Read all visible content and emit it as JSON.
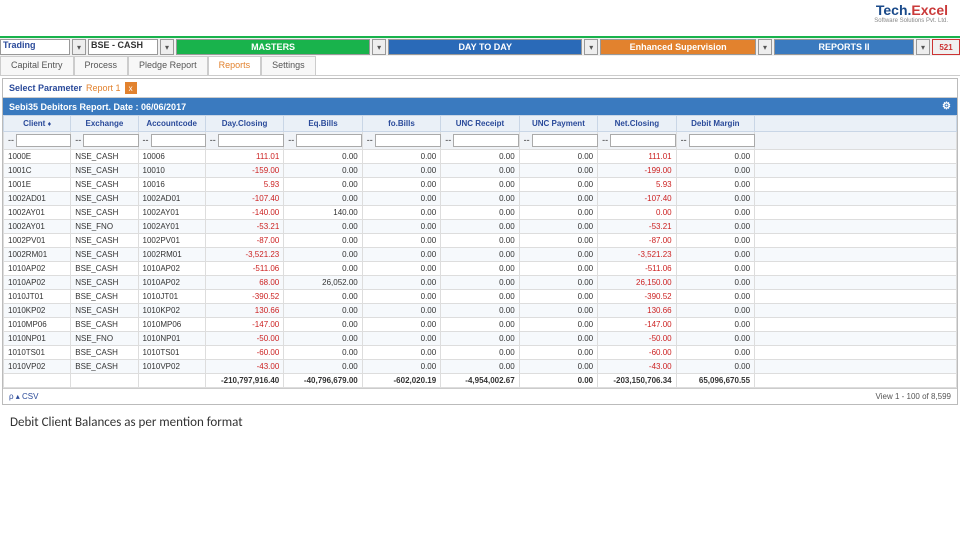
{
  "brand": {
    "name_a": "Tech.",
    "name_b": "Excel",
    "tag": "Software Solutions Pvt. Ltd."
  },
  "topbar": {
    "trading": "Trading",
    "bse": "BSE - CASH",
    "masters": "MASTERS",
    "daytoday": "DAY TO DAY",
    "enhanced": "Enhanced Supervision",
    "reports": "REPORTS II",
    "badge": "521"
  },
  "subnav": {
    "t0": "Capital Entry",
    "t1": "Process",
    "t2": "Pledge Report",
    "t3": "Reports",
    "t4": "Settings"
  },
  "param": {
    "label": "Select Parameter",
    "value": "Report 1",
    "close": "x"
  },
  "title": "Sebi35 Debitors Report. Date : 06/06/2017",
  "headers": {
    "client": "Client",
    "exchange": "Exchange",
    "account": "Accountcode",
    "dayclosing": "Day.Closing",
    "eqbills": "Eq.Bills",
    "fobills": "fo.Bills",
    "uncreceipt": "UNC Receipt",
    "uncpayment": "UNC Payment",
    "netclosing": "Net.Closing",
    "debitmargin": "Debit Margin"
  },
  "filter_dash": "--",
  "rows": [
    {
      "c": "1000E",
      "e": "NSE_CASH",
      "a": "10006",
      "dc": "111.01",
      "eq": "0.00",
      "fo": "0.00",
      "ur": "0.00",
      "up": "0.00",
      "nc": "111.01",
      "dm": "0.00",
      "dcn": false,
      "ncn": false
    },
    {
      "c": "1001C",
      "e": "NSE_CASH",
      "a": "10010",
      "dc": "-159.00",
      "eq": "0.00",
      "fo": "0.00",
      "ur": "0.00",
      "up": "0.00",
      "nc": "-199.00",
      "dm": "0.00",
      "dcn": true,
      "ncn": true
    },
    {
      "c": "1001E",
      "e": "NSE_CASH",
      "a": "10016",
      "dc": "5.93",
      "eq": "0.00",
      "fo": "0.00",
      "ur": "0.00",
      "up": "0.00",
      "nc": "5.93",
      "dm": "0.00",
      "dcn": false,
      "ncn": false
    },
    {
      "c": "1002AD01",
      "e": "NSE_CASH",
      "a": "1002AD01",
      "dc": "-107.40",
      "eq": "0.00",
      "fo": "0.00",
      "ur": "0.00",
      "up": "0.00",
      "nc": "-107.40",
      "dm": "0.00",
      "dcn": true,
      "ncn": true
    },
    {
      "c": "1002AY01",
      "e": "NSE_CASH",
      "a": "1002AY01",
      "dc": "-140.00",
      "eq": "140.00",
      "fo": "0.00",
      "ur": "0.00",
      "up": "0.00",
      "nc": "0.00",
      "dm": "0.00",
      "dcn": true,
      "ncn": false
    },
    {
      "c": "1002AY01",
      "e": "NSE_FNO",
      "a": "1002AY01",
      "dc": "-53.21",
      "eq": "0.00",
      "fo": "0.00",
      "ur": "0.00",
      "up": "0.00",
      "nc": "-53.21",
      "dm": "0.00",
      "dcn": true,
      "ncn": true
    },
    {
      "c": "1002PV01",
      "e": "NSE_CASH",
      "a": "1002PV01",
      "dc": "-87.00",
      "eq": "0.00",
      "fo": "0.00",
      "ur": "0.00",
      "up": "0.00",
      "nc": "-87.00",
      "dm": "0.00",
      "dcn": true,
      "ncn": true
    },
    {
      "c": "1002RM01",
      "e": "NSE_CASH",
      "a": "1002RM01",
      "dc": "-3,521.23",
      "eq": "0.00",
      "fo": "0.00",
      "ur": "0.00",
      "up": "0.00",
      "nc": "-3,521.23",
      "dm": "0.00",
      "dcn": true,
      "ncn": true
    },
    {
      "c": "1010AP02",
      "e": "BSE_CASH",
      "a": "1010AP02",
      "dc": "-511.06",
      "eq": "0.00",
      "fo": "0.00",
      "ur": "0.00",
      "up": "0.00",
      "nc": "-511.06",
      "dm": "0.00",
      "dcn": true,
      "ncn": true
    },
    {
      "c": "1010AP02",
      "e": "NSE_CASH",
      "a": "1010AP02",
      "dc": "68.00",
      "eq": "26,052.00",
      "fo": "0.00",
      "ur": "0.00",
      "up": "0.00",
      "nc": "26,150.00",
      "dm": "0.00",
      "dcn": false,
      "ncn": false
    },
    {
      "c": "1010JT01",
      "e": "BSE_CASH",
      "a": "1010JT01",
      "dc": "-390.52",
      "eq": "0.00",
      "fo": "0.00",
      "ur": "0.00",
      "up": "0.00",
      "nc": "-390.52",
      "dm": "0.00",
      "dcn": true,
      "ncn": true
    },
    {
      "c": "1010KP02",
      "e": "NSE_CASH",
      "a": "1010KP02",
      "dc": "130.66",
      "eq": "0.00",
      "fo": "0.00",
      "ur": "0.00",
      "up": "0.00",
      "nc": "130.66",
      "dm": "0.00",
      "dcn": false,
      "ncn": false
    },
    {
      "c": "1010MP06",
      "e": "BSE_CASH",
      "a": "1010MP06",
      "dc": "-147.00",
      "eq": "0.00",
      "fo": "0.00",
      "ur": "0.00",
      "up": "0.00",
      "nc": "-147.00",
      "dm": "0.00",
      "dcn": true,
      "ncn": true
    },
    {
      "c": "1010NP01",
      "e": "NSE_FNO",
      "a": "1010NP01",
      "dc": "-50.00",
      "eq": "0.00",
      "fo": "0.00",
      "ur": "0.00",
      "up": "0.00",
      "nc": "-50.00",
      "dm": "0.00",
      "dcn": true,
      "ncn": true
    },
    {
      "c": "1010TS01",
      "e": "BSE_CASH",
      "a": "1010TS01",
      "dc": "-60.00",
      "eq": "0.00",
      "fo": "0.00",
      "ur": "0.00",
      "up": "0.00",
      "nc": "-60.00",
      "dm": "0.00",
      "dcn": true,
      "ncn": true
    },
    {
      "c": "1010VP02",
      "e": "BSE_CASH",
      "a": "1010VP02",
      "dc": "-43.00",
      "eq": "0.00",
      "fo": "0.00",
      "ur": "0.00",
      "up": "0.00",
      "nc": "-43.00",
      "dm": "0.00",
      "dcn": true,
      "ncn": true
    }
  ],
  "totals": {
    "dc": "-210,797,916.40",
    "eq": "-40,796,679.00",
    "fo": "-602,020.19",
    "ur": "-4,954,002.67",
    "up": "0.00",
    "nc": "-203,150,706.34",
    "dm": "65,096,670.55"
  },
  "footer": {
    "csv_icon": "ρ",
    "csv": "CSV",
    "view": "View 1 - 100 of 8,599"
  },
  "caption": "Debit Client Balances as per mention format"
}
